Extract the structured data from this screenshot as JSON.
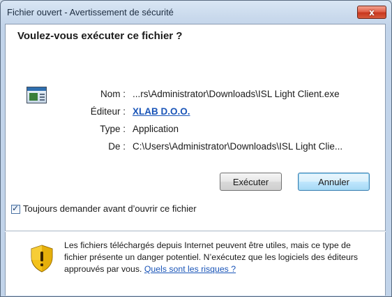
{
  "window": {
    "title": "Fichier ouvert - Avertissement de sécurité",
    "close_glyph": "x",
    "close_color": "#d0462a"
  },
  "dialog": {
    "heading": "Voulez-vous exécuter ce fichier ?",
    "file_icon": "application-window-icon",
    "details": [
      {
        "label": "Nom :",
        "value": "...rs\\Administrator\\Downloads\\ISL Light Client.exe",
        "link": false
      },
      {
        "label": "Éditeur :",
        "value": "XLAB D.O.O.",
        "link": true
      },
      {
        "label": "Type :",
        "value": "Application",
        "link": false
      },
      {
        "label": "De :",
        "value": "C:\\Users\\Administrator\\Downloads\\ISL Light Clie...",
        "link": false
      }
    ],
    "buttons": {
      "run_label": "Exécuter",
      "cancel_label": "Annuler"
    },
    "always_ask": {
      "checked": true,
      "label": "Toujours demander avant d’ouvrir ce fichier"
    },
    "warning": {
      "icon": "security-shield-icon",
      "text": "Les fichiers téléchargés depuis Internet peuvent être utiles, mais ce type de fichier présente un danger potentiel. N’exécutez que les logiciels des éditeurs approuvés par vous.",
      "link_text": "Quels sont les risques ?"
    }
  },
  "colors": {
    "link": "#1a55b8",
    "shield_yellow": "#f4c21a"
  }
}
